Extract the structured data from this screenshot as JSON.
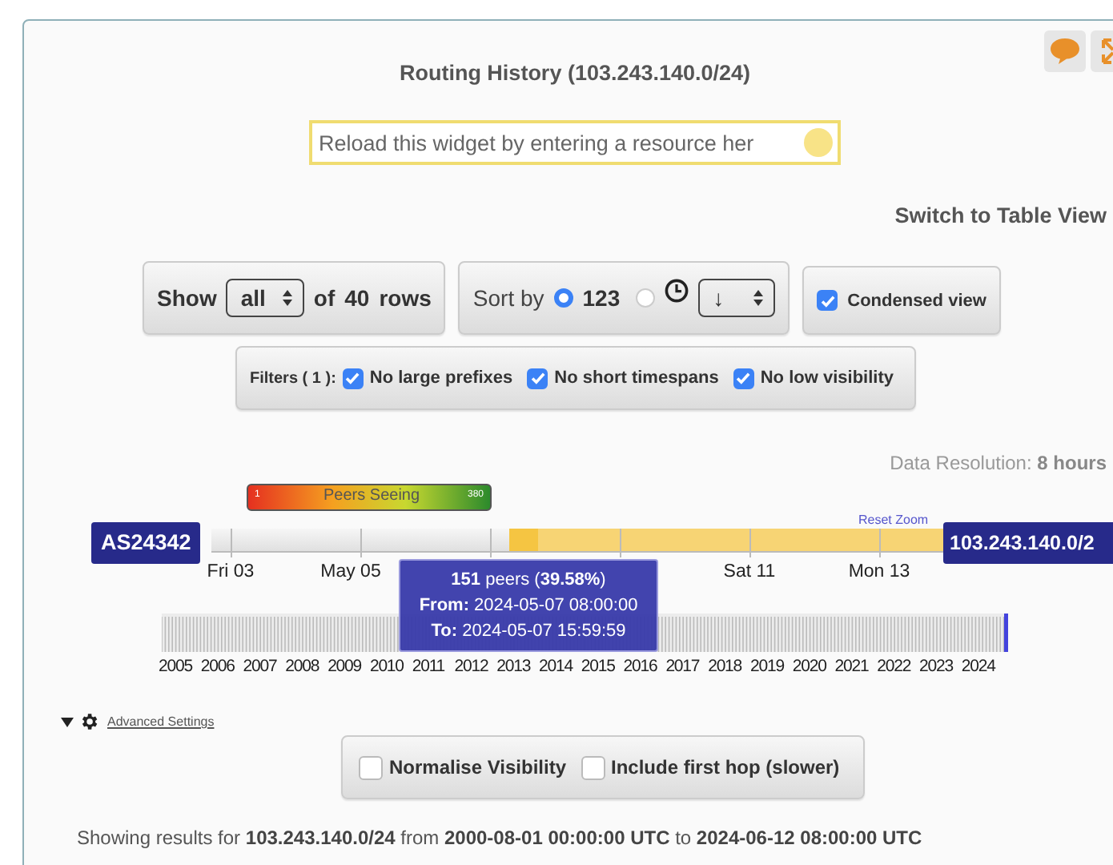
{
  "widget": {
    "title": "Routing History (103.243.140.0/24)",
    "resource_field": {
      "placeholder": "Reload this widget by entering a resource her"
    },
    "table_view_link": "Switch to Table View"
  },
  "controls": {
    "show": {
      "label": "Show",
      "select": "all",
      "of": "of",
      "count": "40",
      "rows": "rows"
    },
    "sort": {
      "label": "Sort by",
      "options": [
        {
          "kind": "text",
          "label": "123",
          "selected": true
        },
        {
          "kind": "clock",
          "selected": false
        }
      ],
      "order": "↓"
    },
    "condensed": {
      "label": "Condensed view",
      "checked": true
    }
  },
  "filters": {
    "label": "Filters ( 1 ):",
    "items": [
      {
        "label": "No large prefixes",
        "checked": true
      },
      {
        "label": "No short timespans",
        "checked": true
      },
      {
        "label": "No low visibility",
        "checked": true
      }
    ]
  },
  "data_resolution": {
    "label": "Data Resolution:",
    "value": "8 hours"
  },
  "legend": {
    "title": "Peers Seeing",
    "min": "1",
    "max": "380"
  },
  "timeline": {
    "reset_zoom": "Reset Zoom",
    "origin": "AS24342",
    "prefix": "103.243.140.0/2",
    "date_ticks": [
      "Fri 03",
      "May 05",
      "Sat 11",
      "Mon 13"
    ],
    "tooltip": [
      "**151** peers (**39.58%**)",
      "**From:** 2024-05-07 08:00:00",
      "**To:** 2024-05-07 15:59:59"
    ],
    "years": [
      "2005",
      "2006",
      "2007",
      "2008",
      "2009",
      "2010",
      "2011",
      "2012",
      "2013",
      "2014",
      "2015",
      "2016",
      "2017",
      "2018",
      "2019",
      "2020",
      "2021",
      "2022",
      "2023",
      "2024"
    ]
  },
  "advanced": {
    "label": "Advanced Settings",
    "expanded": true,
    "options": [
      {
        "label": "Normalise Visibility",
        "checked": false
      },
      {
        "label": "Include first hop (slower)",
        "checked": false
      }
    ]
  },
  "summary": "Showing results for **103.243.140.0/24** from **2000-08-01 00:00:00 UTC** to **2024-06-12 08:00:00 UTC**"
}
